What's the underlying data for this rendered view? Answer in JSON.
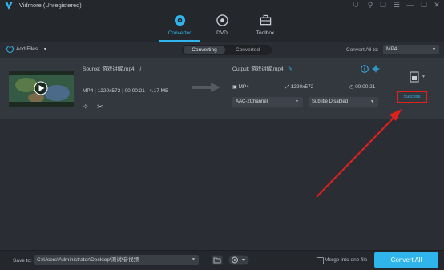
{
  "window": {
    "title": "Vidmore (Unregistered)",
    "controls": {
      "cart": "⛉",
      "key": "⚲",
      "feedback": "☐",
      "menu": "☰",
      "minimize": "—",
      "maximize": "☐",
      "close": "✕"
    }
  },
  "nav": {
    "tabs": [
      {
        "label": "Converter",
        "icon": "converter-icon"
      },
      {
        "label": "DVD",
        "icon": "dvd-icon"
      },
      {
        "label": "Toolbox",
        "icon": "toolbox-icon"
      }
    ]
  },
  "toolbar": {
    "add_files": "Add Files",
    "add_files_caret": "▾",
    "status_tabs": [
      "Converting",
      "Converted"
    ],
    "convert_all_to_label": "Convert All to:",
    "convert_all_to_value": "MP4"
  },
  "file": {
    "source_label": "Source:",
    "source_name": "游戏讲解.mp4",
    "format": "MP4",
    "resolution": "1220x572",
    "duration": "00:00:21",
    "size": "4.17 MB",
    "output_label": "Output:",
    "output_name": "游戏讲解.mp4",
    "out_format": "MP4",
    "out_resolution": "1220x572",
    "out_duration": "00:00:21",
    "audio": "AAC-2Channel",
    "subtitle": "Subtitle Disabled",
    "status": "Success"
  },
  "bottom": {
    "save_to_label": "Save to:",
    "save_path": "C:\\Users\\Administrator\\Desktop\\测试\\音视频",
    "merge_label": "Merge into one file",
    "convert_button": "Convert All"
  },
  "colors": {
    "accent": "#2fb5ec",
    "highlight": "#e0201c",
    "background": "#2a2d33"
  }
}
